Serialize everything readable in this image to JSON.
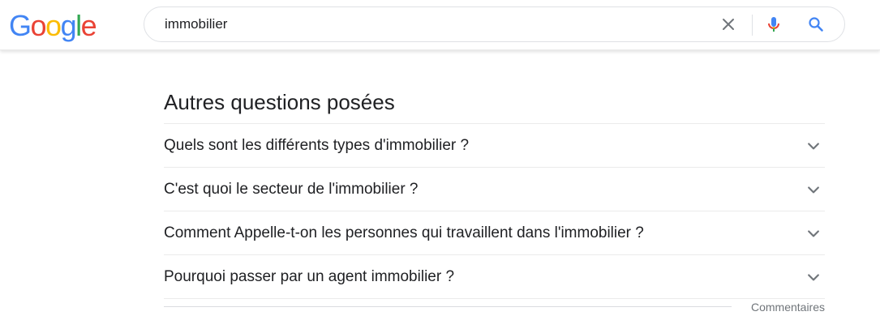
{
  "logo": {
    "letters": [
      "G",
      "o",
      "o",
      "g",
      "l",
      "e"
    ],
    "colors": [
      "#4285f4",
      "#ea4335",
      "#fbbc05",
      "#4285f4",
      "#34a853",
      "#ea4335"
    ]
  },
  "search": {
    "value": "immobilier",
    "clear_icon": "close-icon",
    "mic_icon": "microphone-icon",
    "search_icon": "magnifier-icon"
  },
  "paa": {
    "title": "Autres questions posées",
    "questions": [
      "Quels sont les différents types d'immobilier ?",
      "C'est quoi le secteur de l'immobilier ?",
      "Comment Appelle-t-on les personnes qui travaillent dans l'immobilier ?",
      "Pourquoi passer par un agent immobilier ?"
    ],
    "expand_icon": "chevron-down-icon",
    "feedback_label": "Commentaires"
  },
  "colors": {
    "text": "#202124",
    "secondary_text": "#70757a",
    "divider": "#ebebeb",
    "icon_grey": "#70757a",
    "accent_blue": "#4285f4"
  }
}
